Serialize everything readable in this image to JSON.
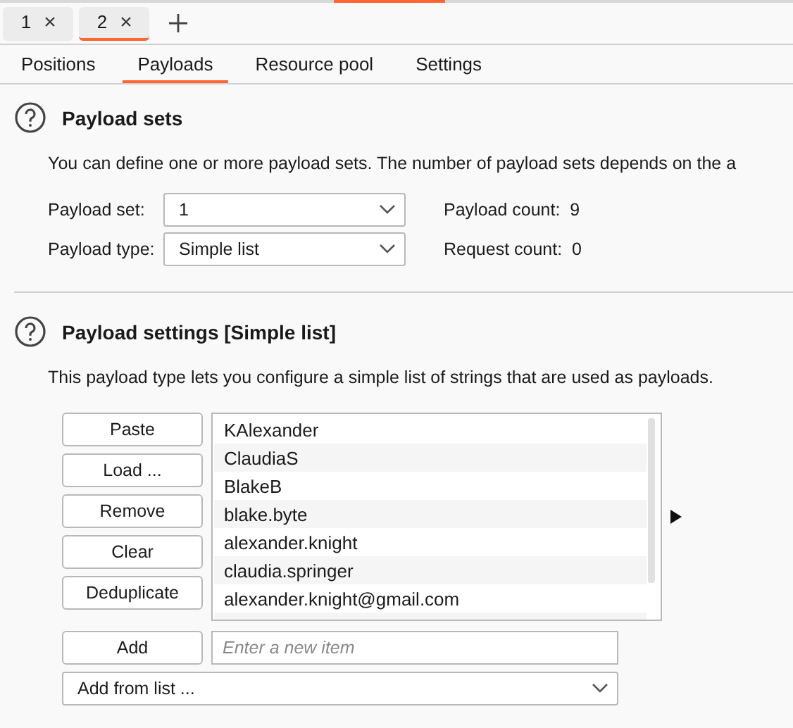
{
  "doc_tabs": [
    {
      "label": "1",
      "selected": false
    },
    {
      "label": "2",
      "selected": true
    }
  ],
  "sub_tabs": [
    {
      "label": "Positions",
      "selected": false
    },
    {
      "label": "Payloads",
      "selected": true
    },
    {
      "label": "Resource pool",
      "selected": false
    },
    {
      "label": "Settings",
      "selected": false
    }
  ],
  "payload_sets": {
    "title": "Payload sets",
    "description": "You can define one or more payload sets. The number of payload sets depends on the a",
    "fields": [
      {
        "label": "Payload set:",
        "value": "1",
        "count_label": "Payload count:",
        "count": "9"
      },
      {
        "label": "Payload type:",
        "value": "Simple list",
        "count_label": "Request count:",
        "count": "0"
      }
    ]
  },
  "payload_settings": {
    "title": "Payload settings [Simple list]",
    "description": "This payload type lets you configure a simple list of strings that are used as payloads.",
    "buttons": [
      "Paste",
      "Load ...",
      "Remove",
      "Clear",
      "Deduplicate"
    ],
    "items": [
      "KAlexander",
      "ClaudiaS",
      "BlakeB",
      "blake.byte",
      "alexander.knight",
      "claudia.springer",
      "alexander.knight@gmail.com"
    ],
    "add_button": "Add",
    "new_item": {
      "placeholder": "Enter a new item"
    },
    "add_from_list": "Add from list ..."
  }
}
